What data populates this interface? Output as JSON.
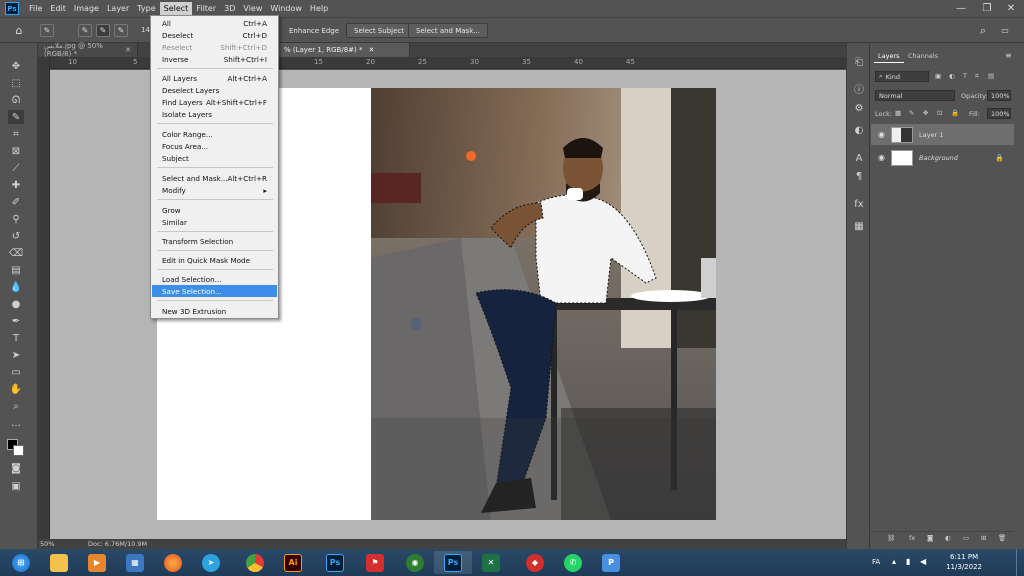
{
  "menubar": {
    "items": [
      "File",
      "Edit",
      "Image",
      "Layer",
      "Type",
      "Select",
      "Filter",
      "3D",
      "View",
      "Window",
      "Help"
    ],
    "active": "Select"
  },
  "options": {
    "size_value": "14",
    "enhance_edge": "Enhance Edge",
    "select_subject": "Select Subject",
    "select_and_mask": "Select and Mask..."
  },
  "tabs": [
    {
      "label": "ملابس.jpg @ 50% (RGB/8) *",
      "active": false
    },
    {
      "label": "% (Layer 1, RGB/8#) *",
      "active": true
    }
  ],
  "ruler": [
    "10",
    "5",
    "0",
    "5",
    "10",
    "15",
    "20",
    "25",
    "30",
    "35",
    "40",
    "45"
  ],
  "select_menu": {
    "items": [
      {
        "label": "All",
        "shortcut": "Ctrl+A"
      },
      {
        "label": "Deselect",
        "shortcut": "Ctrl+D"
      },
      {
        "label": "Reselect",
        "shortcut": "Shift+Ctrl+D",
        "disabled": true
      },
      {
        "label": "Inverse",
        "shortcut": "Shift+Ctrl+I"
      },
      {
        "separator": true
      },
      {
        "label": "All Layers",
        "shortcut": "Alt+Ctrl+A"
      },
      {
        "label": "Deselect Layers",
        "shortcut": ""
      },
      {
        "label": "Find Layers",
        "shortcut": "Alt+Shift+Ctrl+F"
      },
      {
        "label": "Isolate Layers",
        "shortcut": ""
      },
      {
        "separator": true
      },
      {
        "label": "Color Range...",
        "shortcut": ""
      },
      {
        "label": "Focus Area...",
        "shortcut": ""
      },
      {
        "label": "Subject",
        "shortcut": ""
      },
      {
        "separator": true
      },
      {
        "label": "Select and Mask...",
        "shortcut": "Alt+Ctrl+R"
      },
      {
        "label": "Modify",
        "shortcut": "▸"
      },
      {
        "separator": true
      },
      {
        "label": "Grow",
        "shortcut": ""
      },
      {
        "label": "Similar",
        "shortcut": ""
      },
      {
        "separator": true
      },
      {
        "label": "Transform Selection",
        "shortcut": ""
      },
      {
        "separator": true
      },
      {
        "label": "Edit in Quick Mask Mode",
        "shortcut": ""
      },
      {
        "separator": true
      },
      {
        "label": "Load Selection...",
        "shortcut": ""
      },
      {
        "label": "Save Selection...",
        "shortcut": "",
        "highlighted": true
      },
      {
        "separator": true
      },
      {
        "label": "New 3D Extrusion",
        "shortcut": ""
      }
    ]
  },
  "layers_panel": {
    "tabs": [
      "Layers",
      "Channels"
    ],
    "filter_label": "Kind",
    "blend_mode": "Normal",
    "opacity_label": "Opacity:",
    "opacity_value": "100%",
    "lock_label": "Lock:",
    "fill_label": "Fill:",
    "fill_value": "100%",
    "layers": [
      {
        "name": "Layer 1",
        "selected": true
      },
      {
        "name": "Background",
        "selected": false
      }
    ]
  },
  "status": {
    "zoom": "50%",
    "doc": "Doc: 6.76M/10.9M"
  },
  "taskbar": {
    "lang": "FA",
    "time": "6:11 PM",
    "date": "11/3/2022"
  },
  "colors": {
    "ps_blue": "#31a8ff",
    "menu_highlight": "#3d8ee8",
    "logo_pink": "#e8178a"
  }
}
